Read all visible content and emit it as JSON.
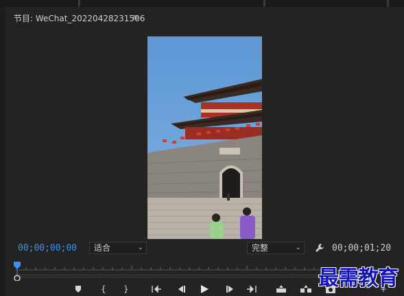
{
  "panel": {
    "title": "节目: WeChat_20220428231506",
    "menu_icon": "hamburger-menu-icon"
  },
  "controls": {
    "current_timecode": "00;00;00;00",
    "zoom_select": "适合",
    "resolution_select": "完整",
    "duration_timecode": "00;00;01;20",
    "settings_icon": "wrench-icon"
  },
  "transport_icons": [
    "add-marker-icon",
    "mark-in-icon",
    "mark-out-icon",
    "go-to-in-icon",
    "step-back-icon",
    "play-icon",
    "step-forward-icon",
    "go-to-out-icon",
    "lift-icon",
    "extract-icon",
    "export-frame-icon",
    "more-controls-icon",
    "add-button-icon"
  ],
  "watermark": "最需教育",
  "colors": {
    "panel_bg": "#232323",
    "timecode_accent": "#3f8ff0",
    "watermark": "#1414b8"
  }
}
